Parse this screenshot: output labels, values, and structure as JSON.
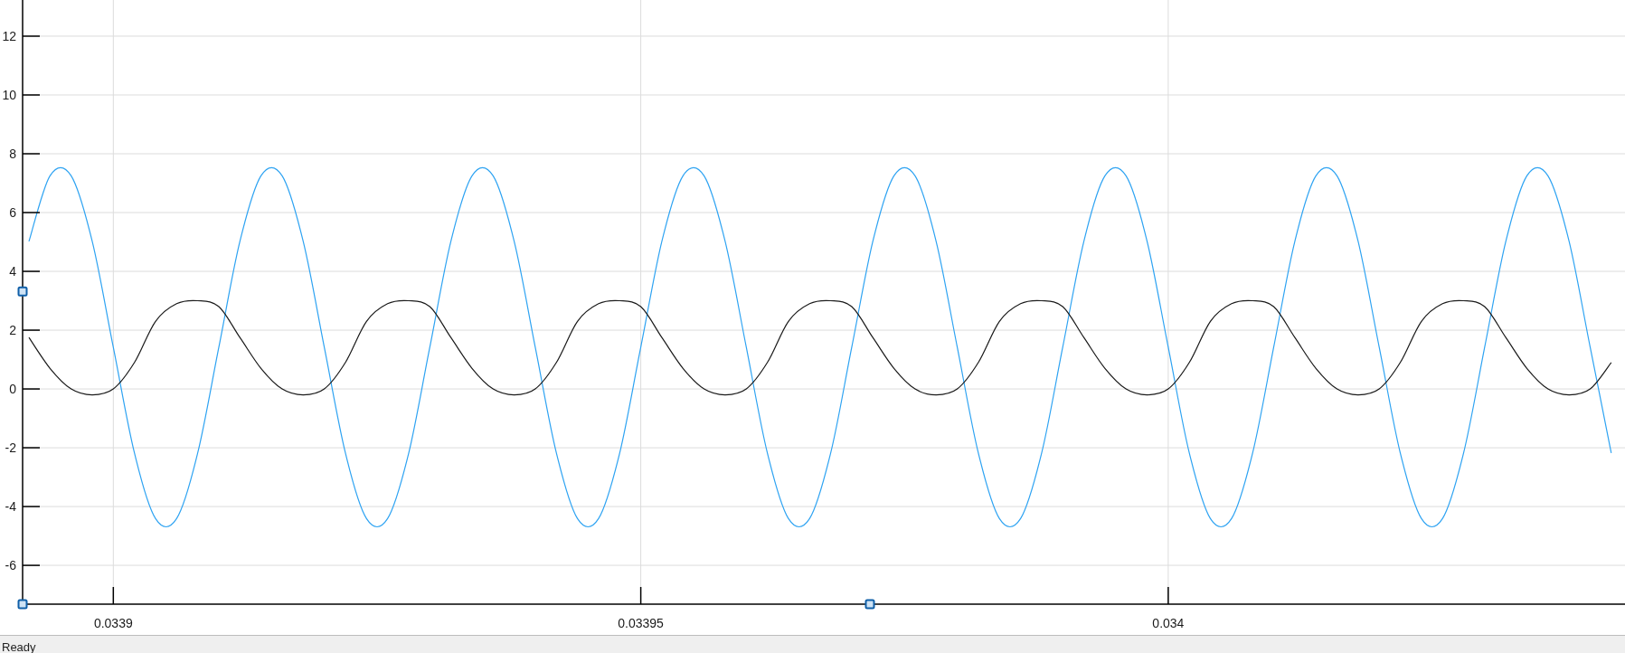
{
  "plot": {
    "chart_data": {
      "type": "line",
      "grid": true,
      "x": [
        0.033892,
        0.033894,
        0.033896,
        0.033898,
        0.0339,
        0.033902,
        0.033904,
        0.033906,
        0.033908,
        0.03391,
        0.033912,
        0.033914,
        0.033916,
        0.033918,
        0.03392,
        0.033922,
        0.033924,
        0.033926,
        0.033928,
        0.03393,
        0.033932,
        0.033934,
        0.033936,
        0.033938,
        0.03394,
        0.033942,
        0.033944,
        0.033946,
        0.033948,
        0.03395,
        0.033952,
        0.033954,
        0.033956,
        0.033958,
        0.03396,
        0.033962,
        0.033964,
        0.033966,
        0.033968,
        0.03397,
        0.033972,
        0.033974,
        0.033976,
        0.033978,
        0.03398,
        0.033982,
        0.033984,
        0.033986,
        0.033988,
        0.03399,
        0.033992,
        0.033994,
        0.033996,
        0.033998,
        0.034,
        0.034002,
        0.034004,
        0.034006,
        0.034008,
        0.03401,
        0.034012,
        0.034014,
        0.034016,
        0.034018,
        0.03402,
        0.034022,
        0.034024,
        0.034026,
        0.034028,
        0.03403,
        0.034032,
        0.034034,
        0.034036,
        0.034038,
        0.03404,
        0.034042
      ],
      "series": [
        {
          "color": "#2ea3f2",
          "values": [
            5.02,
            7.25,
            7.25,
            5.02,
            1.42,
            -2.18,
            -4.41,
            -4.41,
            -2.18,
            1.42,
            5.02,
            7.25,
            7.25,
            5.02,
            1.42,
            -2.18,
            -4.41,
            -4.41,
            -2.18,
            1.42,
            5.02,
            7.25,
            7.25,
            5.02,
            1.42,
            -2.18,
            -4.41,
            -4.41,
            -2.18,
            1.42,
            5.02,
            7.25,
            7.25,
            5.02,
            1.42,
            -2.18,
            -4.41,
            -4.41,
            -2.18,
            1.42,
            5.02,
            7.25,
            7.25,
            5.02,
            1.42,
            -2.18,
            -4.41,
            -4.41,
            -2.18,
            1.42,
            5.02,
            7.25,
            7.25,
            5.02,
            1.42,
            -2.18,
            -4.41,
            -4.41,
            -2.18,
            1.42,
            5.02,
            7.25,
            7.25,
            5.02,
            1.42,
            -2.18,
            -4.41,
            -4.41,
            -2.18,
            1.42,
            5.02,
            7.25,
            7.25,
            5.02,
            1.42,
            -2.18
          ]
        },
        {
          "color": "#1a1a1a",
          "values": [
            1.75,
            0.7,
            0,
            -0.2,
            0,
            0.9,
            2.3,
            2.9,
            3,
            2.8,
            1.75,
            0.7,
            0,
            -0.2,
            0,
            0.9,
            2.3,
            2.9,
            3,
            2.8,
            1.75,
            0.7,
            0,
            -0.2,
            0,
            0.9,
            2.3,
            2.9,
            3,
            2.8,
            1.75,
            0.7,
            0,
            -0.2,
            0,
            0.9,
            2.3,
            2.9,
            3,
            2.8,
            1.75,
            0.7,
            0,
            -0.2,
            0,
            0.9,
            2.3,
            2.9,
            3,
            2.8,
            1.75,
            0.7,
            0,
            -0.2,
            0,
            0.9,
            2.3,
            2.9,
            3,
            2.8,
            1.75,
            0.7,
            0,
            -0.2,
            0,
            0.9,
            2.3,
            2.9,
            3,
            2.8,
            1.75,
            0.7,
            0,
            -0.2,
            0,
            0.9
          ]
        }
      ],
      "xlim": [
        0.0338914,
        0.0340433
      ],
      "ylim": [
        -7.32,
        13.23
      ],
      "xticks": [
        0.0339,
        0.03395,
        0.034
      ],
      "yticks": [
        -6,
        -4,
        -2,
        0,
        2,
        4,
        6,
        8,
        10,
        12
      ]
    }
  },
  "status_bar": {
    "text": "Ready"
  }
}
